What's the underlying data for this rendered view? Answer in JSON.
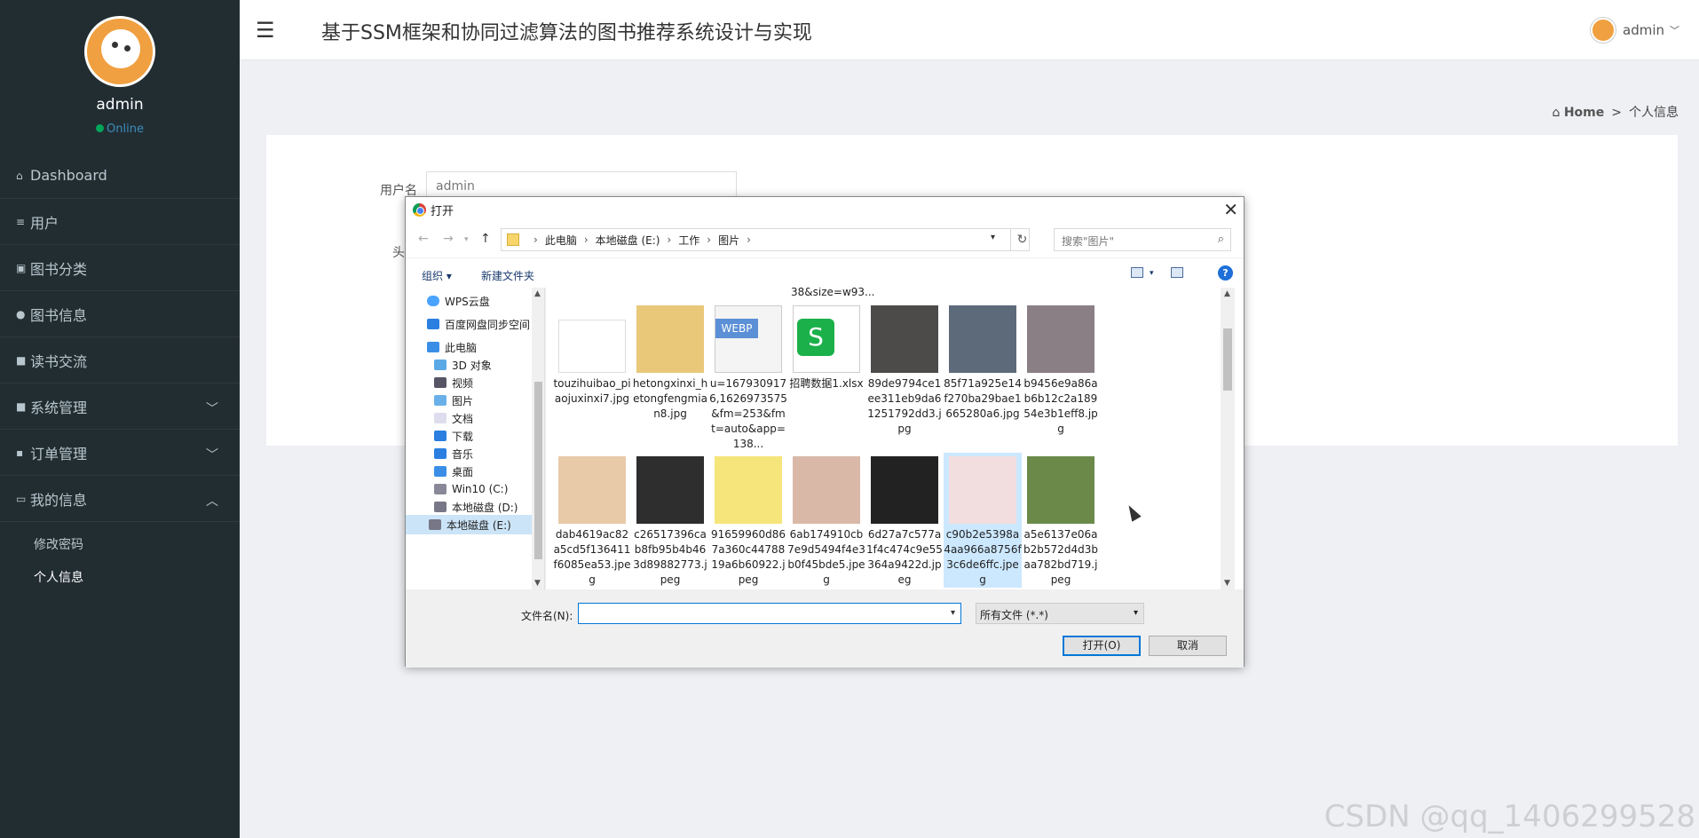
{
  "sidebar": {
    "user_name": "admin",
    "status": "Online",
    "items": [
      {
        "icon": "home-icon",
        "label": "Dashboard"
      },
      {
        "icon": "list-icon",
        "label": "用户"
      },
      {
        "icon": "book-icon",
        "label": "图书分类"
      },
      {
        "icon": "user-icon",
        "label": "图书信息"
      },
      {
        "icon": "grid-icon",
        "label": "读书交流"
      },
      {
        "icon": "grid-icon",
        "label": "系统管理"
      },
      {
        "icon": "comment-icon",
        "label": "订单管理"
      },
      {
        "icon": "card-icon",
        "label": "我的信息"
      }
    ],
    "sub_items": [
      "修改密码",
      "个人信息"
    ]
  },
  "topbar": {
    "title": "基于SSM框架和协同过滤算法的图书推荐系统设计与实现",
    "user": "admin"
  },
  "breadcrumb": {
    "home": "Home",
    "sep": ">",
    "current": "个人信息"
  },
  "form": {
    "username_label": "用户名",
    "username_value": "admin",
    "avatar_label": "头"
  },
  "dialog": {
    "title": "打开",
    "path": [
      "此电脑",
      "本地磁盘 (E:)",
      "工作",
      "图片"
    ],
    "search_placeholder": "搜索\"图片\"",
    "organize": "组织 ▾",
    "new_folder": "新建文件夹",
    "help": "?",
    "nav": [
      "WPS云盘",
      "百度网盘同步空间",
      "此电脑",
      "3D 对象",
      "视频",
      "图片",
      "文档",
      "下载",
      "音乐",
      "桌面",
      "Win10 (C:)",
      "本地磁盘 (D:)",
      "本地磁盘 (E:)"
    ],
    "top_partial": "38&size=w93...",
    "files": [
      "touzihuibao_piaojuxinxi7.jpg",
      "hetongxinxi_hetongfengmian8.jpg",
      "u=1679309176,1626973575&fm=253&fmt=auto&app=138...",
      "招聘数据1.xlsx",
      "89de9794ce1ee311eb9da61251792dd3.jpg",
      "85f71a925e14f270ba29bae1665280a6.jpg",
      "b9456e9a86ab6b12c2a18954e3b1eff8.jpg",
      "dab4619ac82a5cd5f136411f6085ea53.jpeg",
      "c26517396cab8fb95b4b463d89882773.jpeg",
      "91659960d867a360c4478819a6b60922.jpeg",
      "6ab174910cb7e9d5494f4e3b0f45bde5.jpeg",
      "6d27a7c577a1f4c474c9e55364a9422d.jpeg",
      "c90b2e5398a4aa966a8756f3c6de6ffc.jpeg",
      "a5e6137e06ab2b572d4d3baa782bd719.jpeg"
    ],
    "filename_label": "文件名(N):",
    "filename_value": "",
    "filetype": "所有文件 (*.*)",
    "open": "打开(O)",
    "cancel": "取消"
  },
  "watermark": "CSDN @qq_1406299528"
}
